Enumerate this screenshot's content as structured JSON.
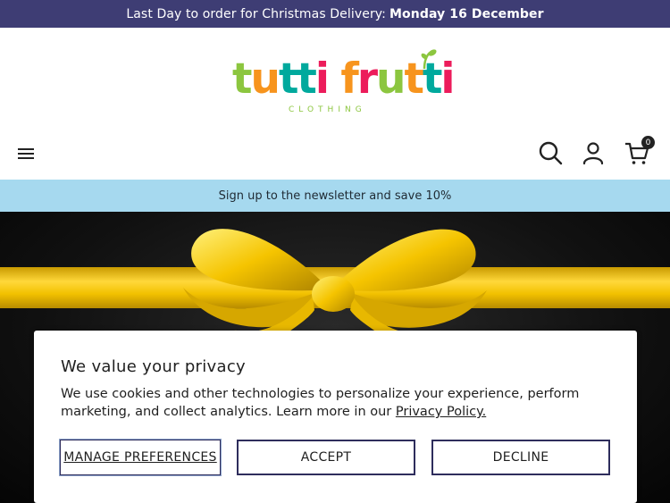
{
  "announcement": {
    "text": "Last Day to order for Christmas Delivery:",
    "highlight": "Monday 16 December",
    "background": "#3e3d74"
  },
  "header": {
    "logo": {
      "word": "tutti frutti",
      "sub": "CLOTHING",
      "letter_colors": [
        "#8cc63f",
        "#f7941d",
        "#00a99d",
        "#00a99d",
        "#ec1c5b",
        "#ffffff",
        "#f7941d",
        "#ec1c5b",
        "#8cc63f",
        "#f7941d",
        "#00a99d",
        "#ec1c5b"
      ]
    },
    "icons": [
      "menu-icon",
      "search-icon",
      "account-icon",
      "cart-icon"
    ],
    "cart_count": "0"
  },
  "newsletter": {
    "text": "Sign up to the newsletter and save 10%",
    "background": "#a6d9ef"
  },
  "privacy_modal": {
    "title": "We value your privacy",
    "body": "We use cookies and other technologies to personalize your experience, perform marketing, and collect analytics. Learn more in our",
    "link": "Privacy Policy.",
    "buttons": {
      "manage": "MANAGE PREFERENCES",
      "accept": "ACCEPT",
      "decline": "DECLINE"
    },
    "accent": "#2e2d5c"
  }
}
